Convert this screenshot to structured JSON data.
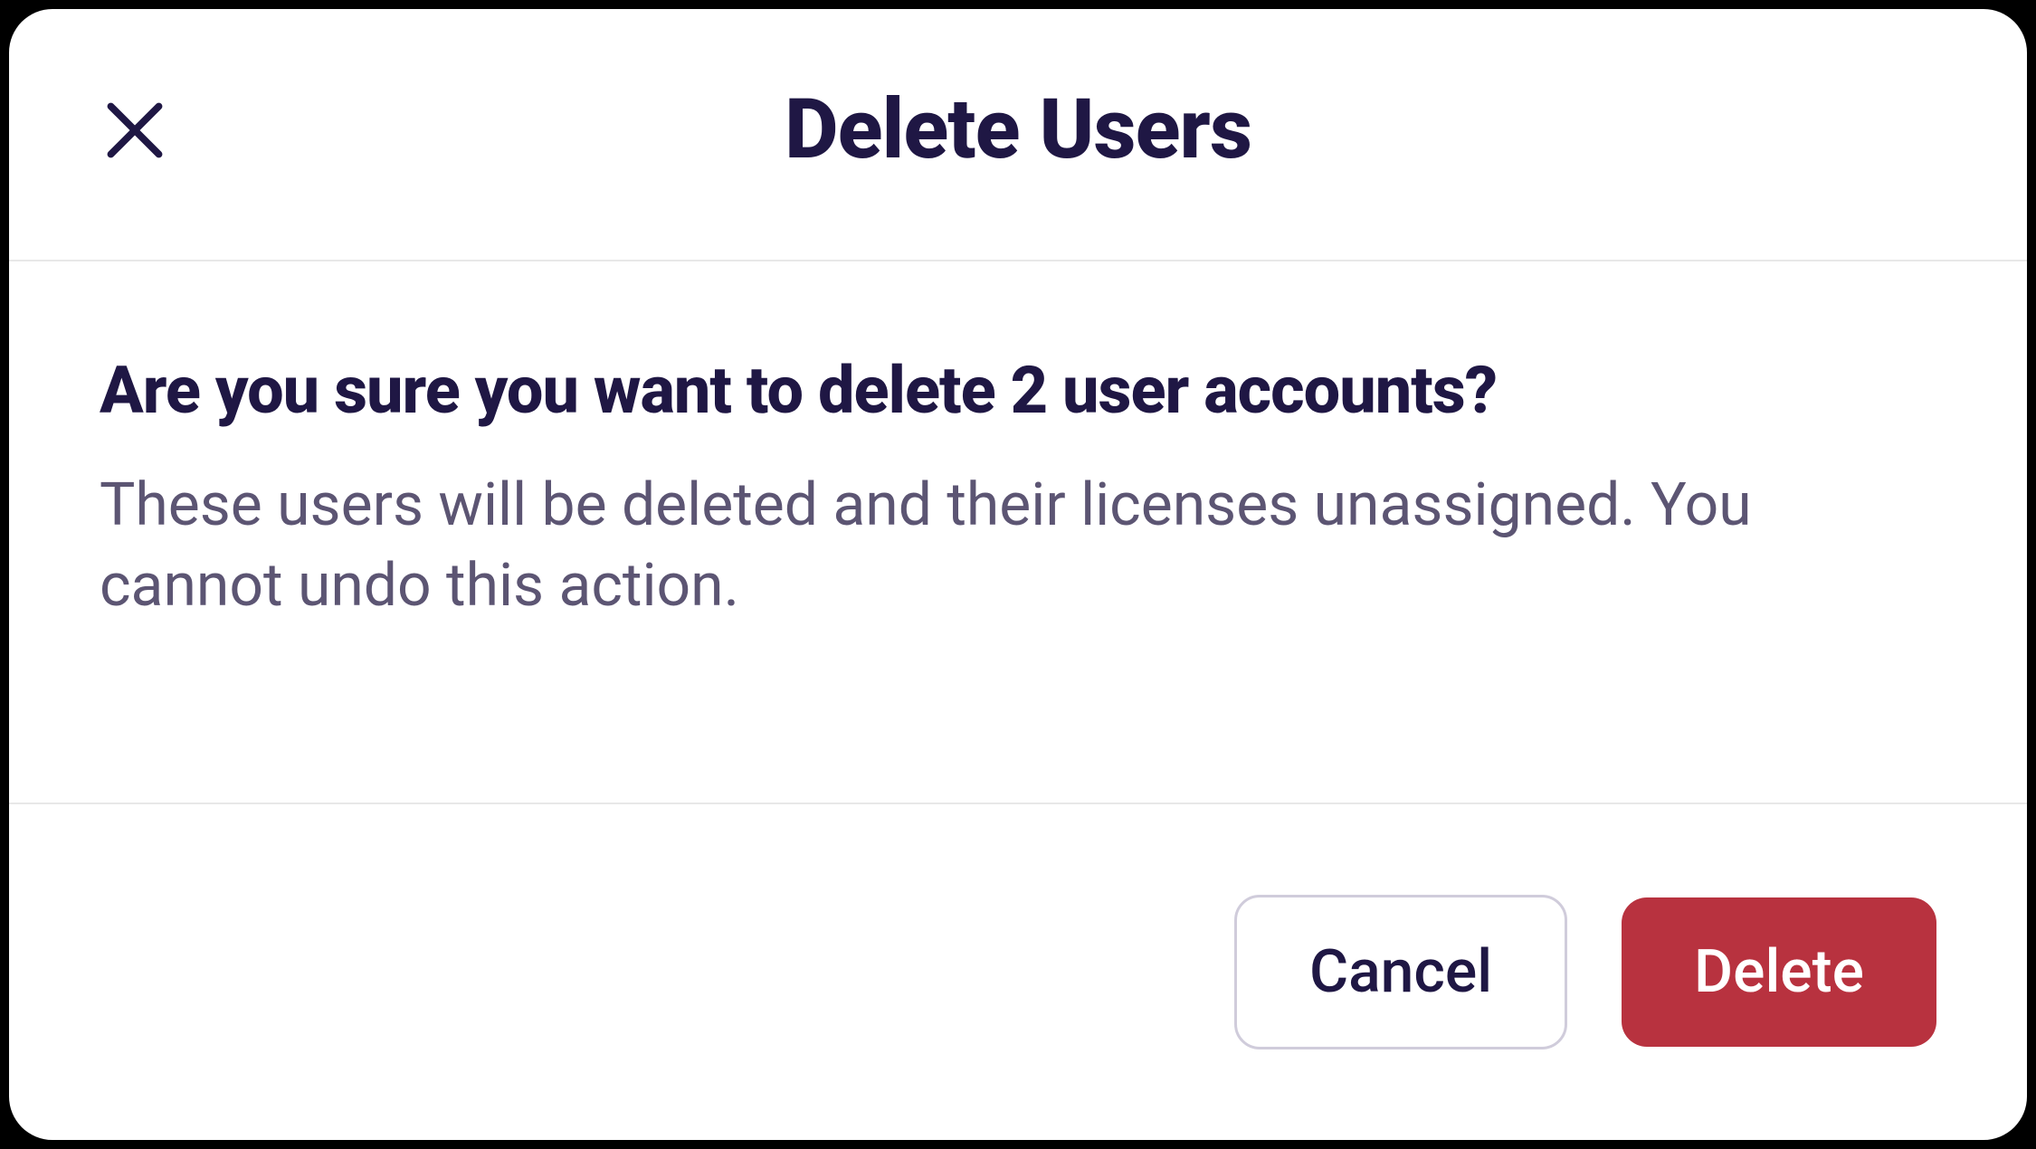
{
  "dialog": {
    "title": "Delete Users",
    "question": "Are you sure you want to delete 2 user accounts?",
    "description": "These users will be deleted and their licenses unassigned. You cannot undo this action.",
    "cancel_label": "Cancel",
    "delete_label": "Delete"
  }
}
